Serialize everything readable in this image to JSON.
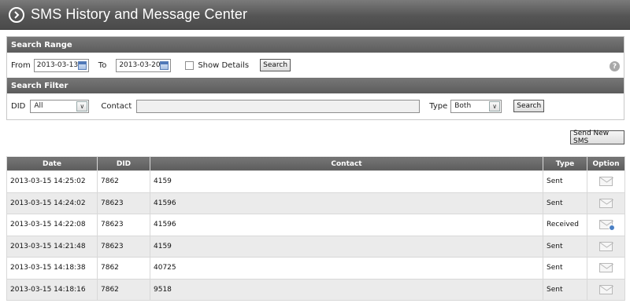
{
  "header": {
    "title": "SMS History and Message Center",
    "icon": "chevron-right-circle-icon"
  },
  "search_range": {
    "heading": "Search Range",
    "from_label": "From",
    "from_value": "2013-03-13",
    "to_label": "To",
    "to_value": "2013-03-20",
    "show_details_label": "Show Details",
    "show_details_checked": false,
    "search_label": "Search",
    "help_icon": "?"
  },
  "search_filter": {
    "heading": "Search Filter",
    "did_label": "DID",
    "did_value": "All",
    "contact_label": "Contact",
    "contact_value": "",
    "type_label": "Type",
    "type_value": "Both",
    "search_label": "Search"
  },
  "send_new_sms_label": "Send New SMS",
  "table": {
    "columns": [
      "Date",
      "DID",
      "Contact",
      "Type",
      "Option"
    ],
    "rows": [
      {
        "date": "2013-03-15 14:25:02",
        "did": "7862",
        "contact": "4159",
        "type": "Sent",
        "option": "envelope-icon"
      },
      {
        "date": "2013-03-15 14:24:02",
        "did": "78623",
        "contact": "41596",
        "type": "Sent",
        "option": "envelope-icon"
      },
      {
        "date": "2013-03-15 14:22:08",
        "did": "78623",
        "contact": "41596",
        "type": "Received",
        "option": "envelope-reply-icon"
      },
      {
        "date": "2013-03-15 14:21:48",
        "did": "78623",
        "contact": "4159",
        "type": "Sent",
        "option": "envelope-icon"
      },
      {
        "date": "2013-03-15 14:18:38",
        "did": "7862",
        "contact": "40725",
        "type": "Sent",
        "option": "envelope-icon"
      },
      {
        "date": "2013-03-15 14:18:16",
        "did": "7862",
        "contact": "9518",
        "type": "Sent",
        "option": "envelope-icon"
      }
    ]
  },
  "colors": {
    "header_bg": "#5c5c5c",
    "row_alt": "#ebebeb",
    "accent": "#4a7fc4"
  }
}
